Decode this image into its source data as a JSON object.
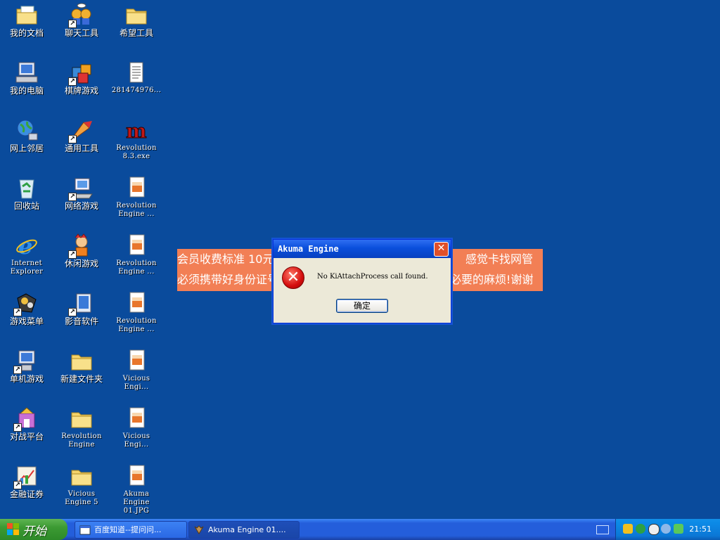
{
  "desktop": {
    "col1": [
      {
        "label": "我的文档"
      },
      {
        "label": "我的电脑"
      },
      {
        "label": "网上邻居"
      },
      {
        "label": "回收站"
      },
      {
        "label": "Internet Explorer"
      },
      {
        "label": "游戏菜单"
      },
      {
        "label": "单机游戏"
      },
      {
        "label": "对战平台"
      },
      {
        "label": "金融证券"
      }
    ],
    "col2": [
      {
        "label": "聊天工具"
      },
      {
        "label": "棋牌游戏"
      },
      {
        "label": "通用工具"
      },
      {
        "label": "网络游戏"
      },
      {
        "label": "休闲游戏"
      },
      {
        "label": "影音软件"
      },
      {
        "label": "新建文件夹"
      },
      {
        "label": "Revolution Engine"
      },
      {
        "label": "Vicious Engine 5"
      }
    ],
    "col3": [
      {
        "label": "希望工具"
      },
      {
        "label": "281474976..."
      },
      {
        "label": "Revolution 8.3.exe"
      },
      {
        "label": "Revolution Engine ..."
      },
      {
        "label": "Revolution Engine ..."
      },
      {
        "label": "Revolution Engine ..."
      },
      {
        "label": "Vicious Engi..."
      },
      {
        "label": "Vicious Engi..."
      },
      {
        "label": "Akuma Engine 01.JPG"
      }
    ]
  },
  "banner": {
    "line1_left": "会员收费标准 10元",
    "line1_right": "感觉卡找网管",
    "line2_left": "必须携带好身份证号",
    "line2_right": "必要的麻烦!谢谢"
  },
  "dialog": {
    "title": "Akuma Engine",
    "close_label": "✕",
    "message": "No KiAttachProcess call found.",
    "ok_label": "确定"
  },
  "taskbar": {
    "start_label": "开始",
    "tasks": [
      {
        "label": "百度知道--提问问..."
      },
      {
        "label": "Akuma Engine 01...."
      }
    ],
    "clock": "21:51"
  },
  "colors": {
    "desktop": "#0a4b9c",
    "banner": "#f27f55",
    "taskbar": "#245edb",
    "start_button": "#3c9a33"
  }
}
